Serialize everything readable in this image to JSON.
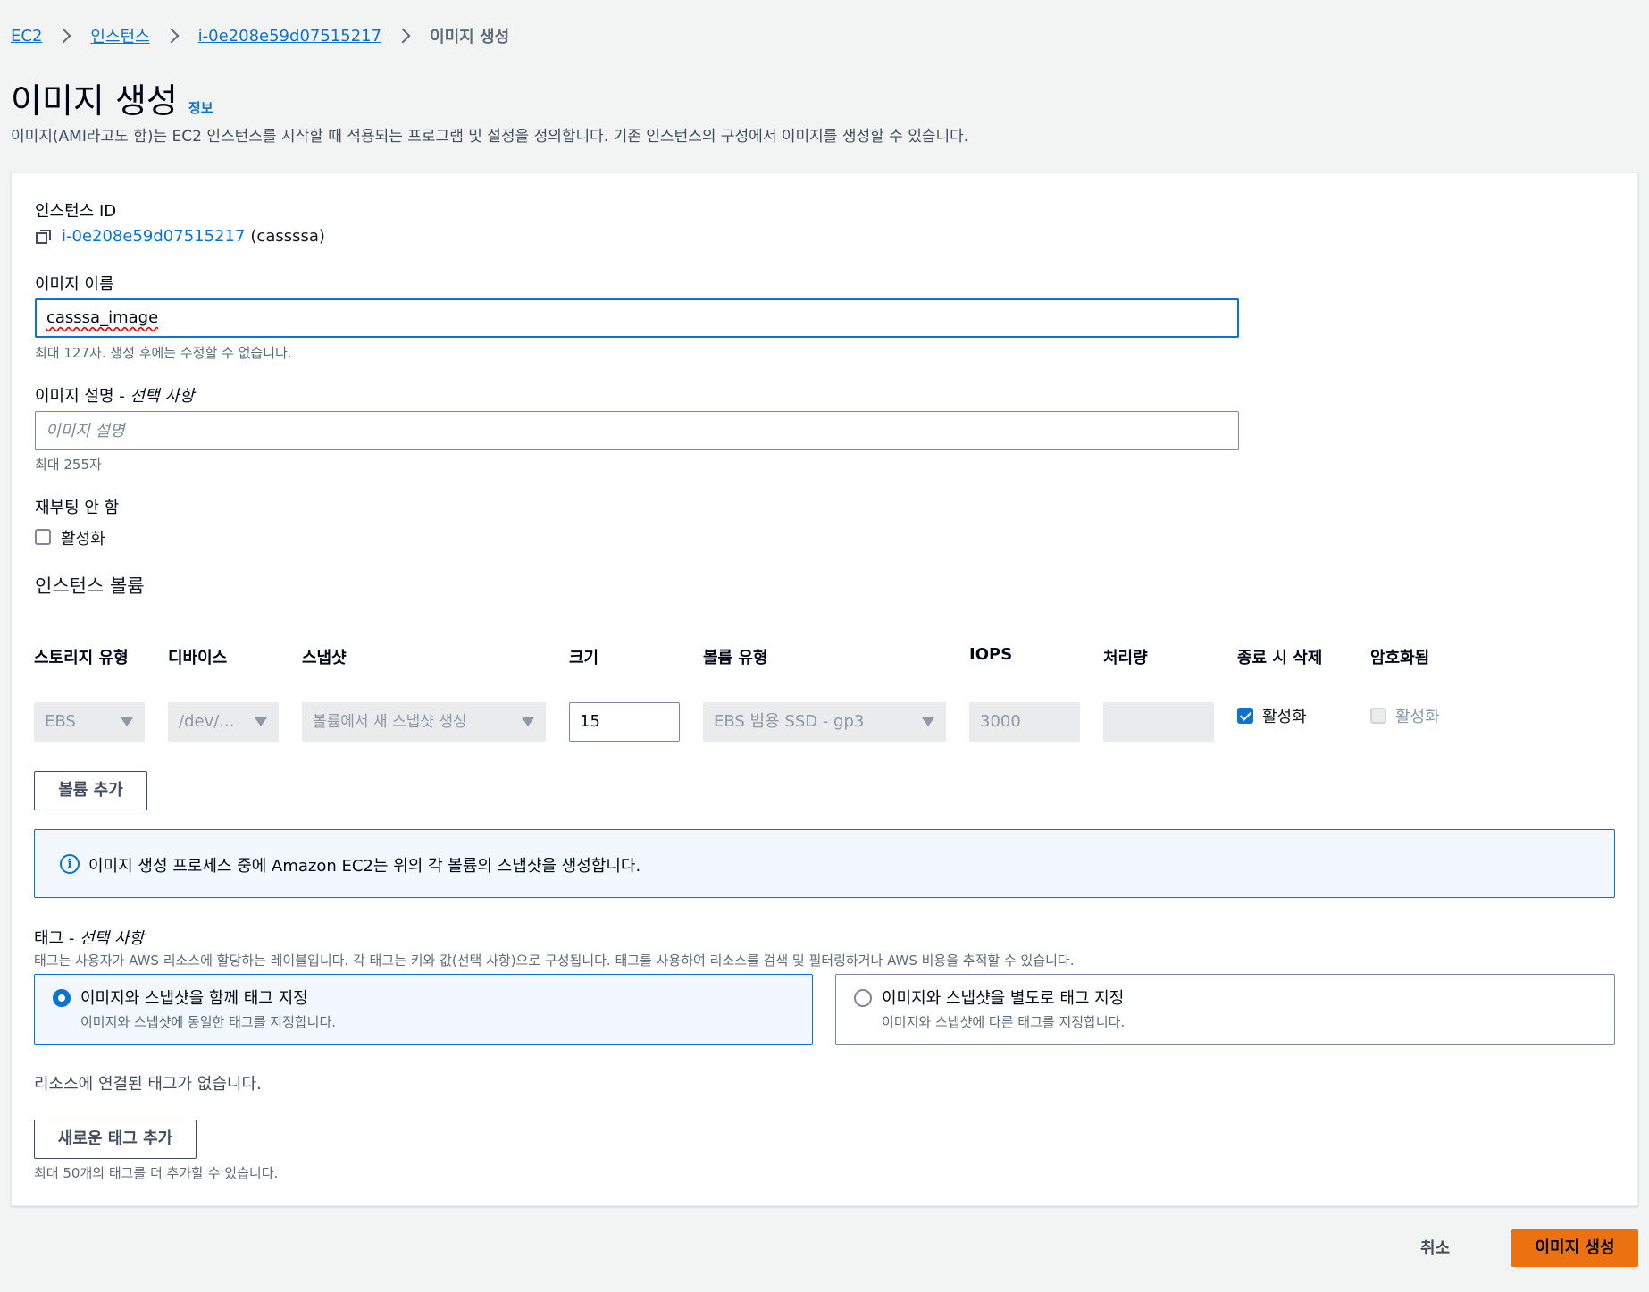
{
  "breadcrumb": {
    "ec2": "EC2",
    "instances": "인스턴스",
    "instance_id": "i-0e208e59d07515217",
    "current": "이미지 생성"
  },
  "header": {
    "title": "이미지 생성",
    "info": "정보",
    "description": "이미지(AMI라고도 함)는 EC2 인스턴스를 시작할 때 적용되는 프로그램 및 설정을 정의합니다. 기존 인스턴스의 구성에서 이미지를 생성할 수 있습니다."
  },
  "instance": {
    "label": "인스턴스 ID",
    "id": "i-0e208e59d07515217",
    "name": "(cassssa)"
  },
  "image_name": {
    "label": "이미지 이름",
    "value": "casssa_image",
    "hint": "최대 127자. 생성 후에는 수정할 수 없습니다."
  },
  "image_description": {
    "label": "이미지 설명 - ",
    "optional": "선택 사항",
    "placeholder": "이미지 설명",
    "hint": "최대 255자"
  },
  "no_reboot": {
    "label": "재부팅 안 함",
    "checkbox_label": "활성화",
    "checked": false
  },
  "volumes": {
    "title": "인스턴스 볼륨",
    "columns": [
      "스토리지 유형",
      "디바이스",
      "스냅샷",
      "크기",
      "볼륨 유형",
      "IOPS",
      "처리량",
      "종료 시 삭제",
      "암호화됨"
    ],
    "row": {
      "storage_type": "EBS",
      "device": "/dev/...",
      "snapshot": "볼륨에서 새 스냅샷 생성",
      "size": "15",
      "volume_type": "EBS 범용 SSD - gp3",
      "iops": "3000",
      "throughput": "",
      "delete_on_termination": "활성화",
      "delete_on_termination_checked": true,
      "encrypted": "활성화",
      "encrypted_checked": false
    },
    "add_button": "볼륨 추가",
    "info_message": "이미지 생성 프로세스 중에 Amazon EC2는 위의 각 볼륨의 스냅샷을 생성합니다."
  },
  "tags": {
    "label": "태그 - ",
    "optional": "선택 사항",
    "description": "태그는 사용자가 AWS 리소스에 할당하는 레이블입니다. 각 태그는 키와 값(선택 사항)으로 구성됩니다. 태그를 사용하여 리소스를 검색 및 필터링하거나 AWS 비용을 추적할 수 있습니다.",
    "option_together_title": "이미지와 스냅샷을 함께 태그 지정",
    "option_together_desc": "이미지와 스냅샷에 동일한 태그를 지정합니다.",
    "option_separate_title": "이미지와 스냅샷을 별도로 태그 지정",
    "option_separate_desc": "이미지와 스냅샷에 다른 태그를 지정합니다.",
    "selected": "together",
    "empty": "리소스에 연결된 태그가 없습니다.",
    "add_button": "새로운 태그 추가",
    "limit_hint": "최대 50개의 태그를 더 추가할 수 있습니다."
  },
  "footer": {
    "cancel": "취소",
    "submit": "이미지 생성"
  },
  "colors": {
    "link": "#0972d3",
    "primary_button": "#ec7211",
    "background": "#f2f3f3"
  }
}
